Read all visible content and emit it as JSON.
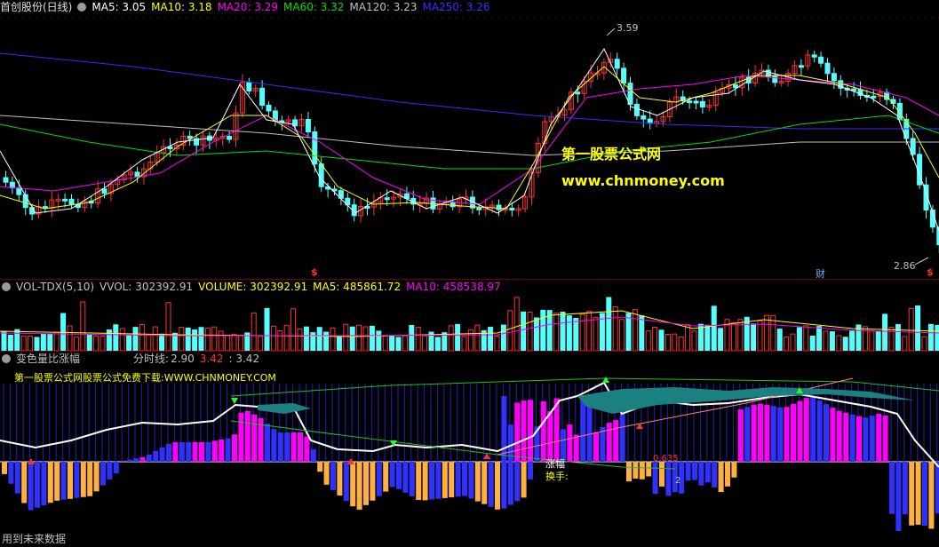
{
  "main": {
    "title": "首创股份(日线)",
    "ma5": "MA5: 3.05",
    "ma10": "MA10: 3.18",
    "ma20": "MA20: 3.29",
    "ma60": "MA60: 3.32",
    "ma120": "MA120: 3.23",
    "ma250": "MA250: 3.26",
    "high_label": "3.59",
    "low_label": "2.86",
    "watermark_cn": "第一股票公式网",
    "watermark_url": "www.chnmoney.com",
    "marker_s1": "$",
    "marker_s2": "$",
    "marker_cai": "财"
  },
  "volume": {
    "title": "VOL-TDX(5,10)",
    "vvol": "VVOL: 302392.91",
    "volume": "VOLUME: 302392.91",
    "ma5": "MA5: 485861.72",
    "ma10": "MA10: 458538.97"
  },
  "indicator": {
    "title": "变色量比涨幅",
    "fenshi_label": "分时线:",
    "val1": "2.90",
    "val2": "3.42",
    "val3": ": 3.42",
    "banner": "第一股票公式网股票公式免费下载:WWW.CHNMONEY.COM",
    "zhangfu": "涨幅",
    "huanshou": "换手:",
    "small_val": "0.635",
    "small_val2": "2"
  },
  "status_bar": {
    "text": "用到未来数据"
  },
  "colors": {
    "up": "#ff3232",
    "down": "#54ffff",
    "ma5": "#ffffff",
    "ma10": "#ffff00",
    "ma20": "#ff00ff",
    "ma60": "#00e000",
    "ma120": "#c0c0c0",
    "ma250": "#3030ff"
  }
}
